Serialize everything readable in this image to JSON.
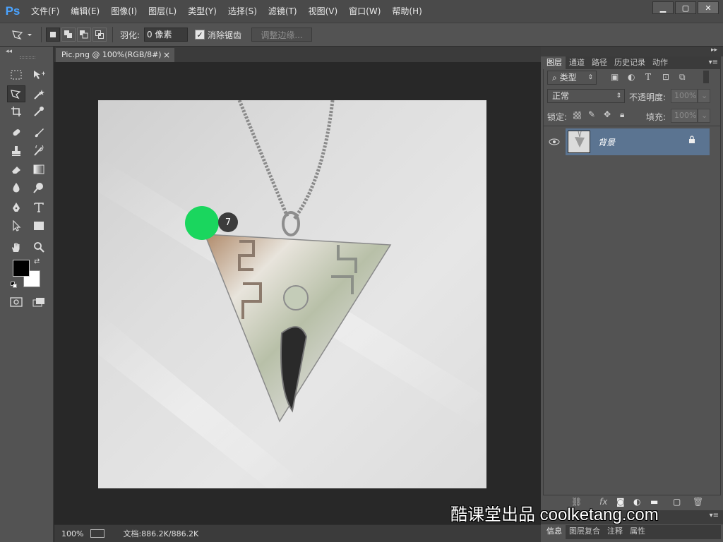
{
  "app": {
    "logo": "Ps"
  },
  "menu": [
    "文件(F)",
    "编辑(E)",
    "图像(I)",
    "图层(L)",
    "类型(Y)",
    "选择(S)",
    "滤镜(T)",
    "视图(V)",
    "窗口(W)",
    "帮助(H)"
  ],
  "window_controls": {
    "minimize": "▁",
    "maximize": "▢",
    "close": "✕"
  },
  "options": {
    "feather_label": "羽化:",
    "feather_value": "0 像素",
    "antialias_label": "消除锯齿",
    "refine_label": "调整边缘..."
  },
  "document": {
    "tab_title": "Pic.png @ 100%(RGB/8#)",
    "close": "×",
    "zoom": "100%",
    "doc_info": "文档:886.2K/886.2K"
  },
  "panel": {
    "tabs": [
      "图层",
      "通道",
      "路径",
      "历史记录",
      "动作"
    ],
    "filter_label": "类型",
    "blend_mode": "正常",
    "opacity_label": "不透明度:",
    "opacity_value": "100%",
    "lock_label": "锁定:",
    "fill_label": "填充:",
    "fill_value": "100%",
    "layer_name": "背景"
  },
  "bottom_tabs": [
    "信息",
    "图层复合",
    "注释",
    "属性"
  ],
  "overlay": {
    "step_badge": "7",
    "watermark": "酷课堂出品 coolketang.com"
  },
  "colors": {
    "accent": "#4aa3ff",
    "layer_highlight": "#5b7491",
    "cursor": "#1ad65e"
  }
}
